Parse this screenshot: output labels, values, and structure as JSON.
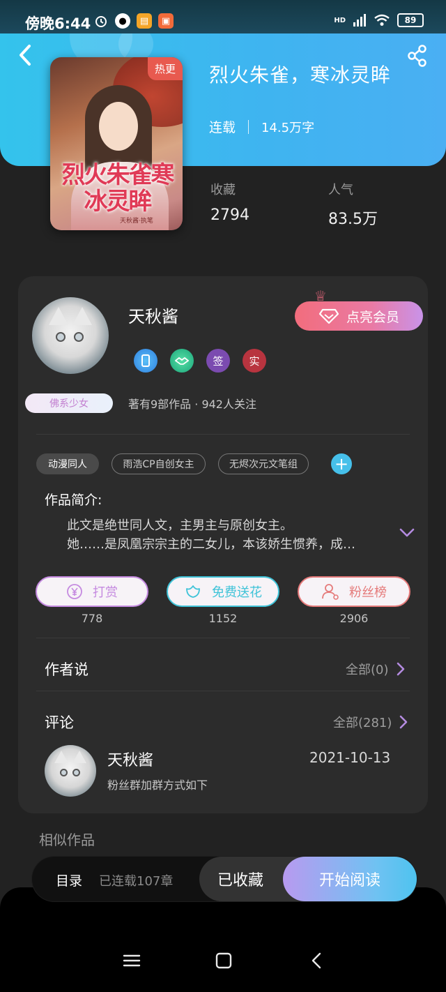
{
  "status_bar": {
    "time": "傍晚6:44",
    "network": "HD",
    "battery": "89"
  },
  "book": {
    "title": "烈火朱雀，寒冰灵眸",
    "status": "连载",
    "word_count": "14.5万字",
    "hot_badge": "热更",
    "cover_title_art": "烈火朱雀寒冰灵眸",
    "cover_subtitle": "天秋酱·执笔"
  },
  "stats": {
    "favorites_label": "收藏",
    "favorites_value": "2794",
    "popularity_label": "人气",
    "popularity_value": "83.5万"
  },
  "author": {
    "name": "天秋酱",
    "vip_button": "点亮会员",
    "badges": [
      "签",
      "实"
    ],
    "persona_tag": "佛系少女",
    "summary": "著有9部作品 · 942人关注"
  },
  "tags": [
    "动漫同人",
    "雨浩CP自创女主",
    "无烬次元文笔组"
  ],
  "intro": {
    "label": "作品简介:",
    "line1": "此文是绝世同人文，主男主与原创女主。",
    "line2": "她……是凤凰宗宗主的二女儿，本该娇生惯养，成…"
  },
  "actions": [
    {
      "label": "打赏",
      "count": "778",
      "color": "#c58ae0"
    },
    {
      "label": "免费送花",
      "count": "1152",
      "color": "#3fc3d8"
    },
    {
      "label": "粉丝榜",
      "count": "2906",
      "color": "#e57a7a"
    }
  ],
  "author_says": {
    "title": "作者说",
    "more": "全部(0)"
  },
  "comments": {
    "title": "评论",
    "more": "全部(281)",
    "items": [
      {
        "name": "天秋酱",
        "date": "2021-10-13",
        "text": "粉丝群加群方式如下"
      }
    ]
  },
  "similar_title": "相似作品",
  "bottom_bar": {
    "toc": "目录",
    "toc_sub": "已连载107章",
    "favorited": "已收藏",
    "start_reading": "开始阅读"
  }
}
